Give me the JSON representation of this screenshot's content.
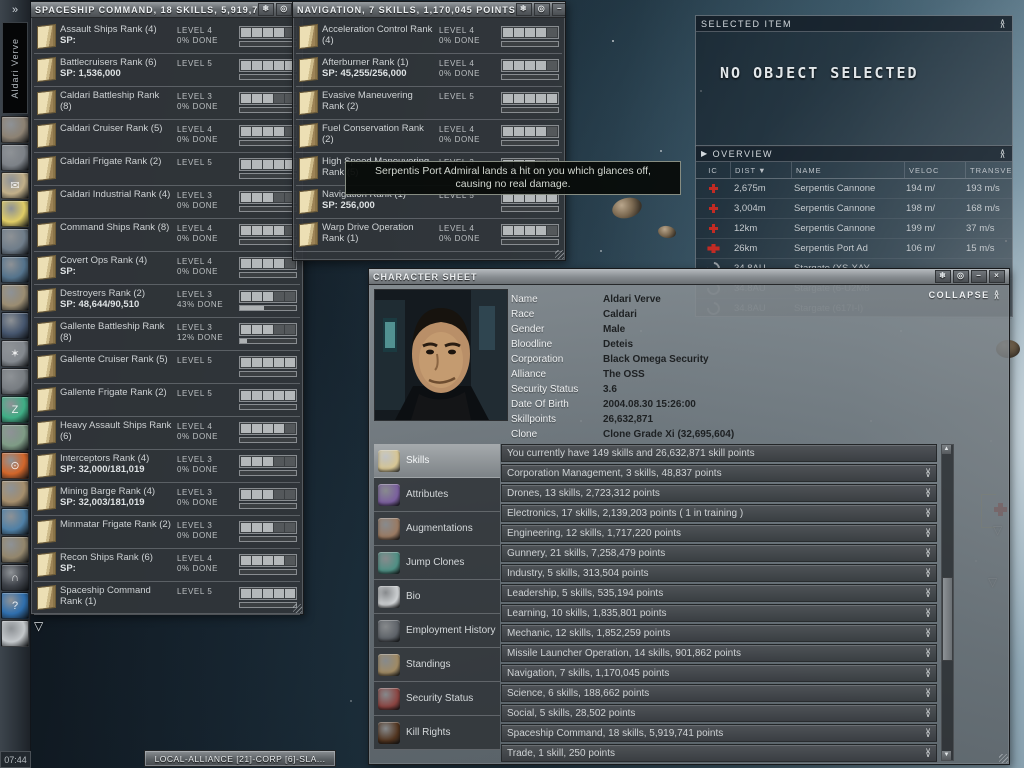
{
  "colors": {
    "hostile_red": "#c42b24",
    "skillbook_beige": "#e8ddb4",
    "accent_grey": "#b4b8ba"
  },
  "window_controls": {
    "pin": "❄",
    "compact": "◎",
    "minimize": "−",
    "close": "×"
  },
  "neocom": {
    "expand_icon": "»",
    "character_name": "Aldari Verve",
    "clock": "07:44",
    "icons": [
      {
        "name": "character-icon",
        "color": "#8d8273",
        "glyph": ""
      },
      {
        "name": "people-places-icon",
        "color": "#7d8288",
        "glyph": ""
      },
      {
        "name": "mail-icon",
        "color": "#c2b089",
        "glyph": "✉"
      },
      {
        "name": "notepad-icon",
        "color": "#e0cd66",
        "glyph": ""
      },
      {
        "name": "map-icon",
        "color": "#6f7d8a",
        "glyph": ""
      },
      {
        "name": "channels-icon",
        "color": "#54738c",
        "glyph": ""
      },
      {
        "name": "news-icon",
        "color": "#9b8d72",
        "glyph": ""
      },
      {
        "name": "fleet-icon",
        "color": "#46566e",
        "glyph": ""
      },
      {
        "name": "standings-stars-icon",
        "color": "#84898f",
        "glyph": "✶"
      },
      {
        "name": "assets-safe-icon",
        "color": "#787d82",
        "glyph": ""
      },
      {
        "name": "science-icon",
        "color": "#3fae85",
        "glyph": "Z"
      },
      {
        "name": "wallet-icon",
        "color": "#7f9c86",
        "glyph": ""
      },
      {
        "name": "help-icon",
        "color": "#d2662a",
        "glyph": "⊙"
      },
      {
        "name": "chat-icon",
        "color": "#a68f6d",
        "glyph": ""
      },
      {
        "name": "browser-globe-icon",
        "color": "#4f80a6",
        "glyph": ""
      },
      {
        "name": "journal-icon",
        "color": "#93866c",
        "glyph": ""
      },
      {
        "name": "audio-icon",
        "color": "#3f434a",
        "glyph": "∩"
      },
      {
        "name": "info-icon",
        "color": "#2f6fae",
        "glyph": "?"
      },
      {
        "name": "avatar-mask-icon",
        "color": "#c4c8cb",
        "glyph": ""
      }
    ]
  },
  "spaceship_window": {
    "title": "SPACESHIP COMMAND, 18 SKILLS, 5,919,7",
    "skills": [
      {
        "name": "Assault Ships Rank (4)",
        "sp": "SP:",
        "level": "LEVEL 4",
        "lv": 4,
        "done": "0% DONE",
        "pct": 0
      },
      {
        "name": "Battlecruisers Rank (6)",
        "sp": "SP: 1,536,000",
        "level": "LEVEL 5",
        "lv": 5,
        "done": "",
        "pct": 0
      },
      {
        "name": "Caldari Battleship Rank (8)",
        "sp": "",
        "level": "LEVEL 3",
        "lv": 3,
        "done": "0% DONE",
        "pct": 0
      },
      {
        "name": "Caldari Cruiser Rank (5)",
        "sp": "",
        "level": "LEVEL 4",
        "lv": 4,
        "done": "0% DONE",
        "pct": 0
      },
      {
        "name": "Caldari Frigate Rank (2)",
        "sp": "",
        "level": "LEVEL 5",
        "lv": 5,
        "done": "",
        "pct": 0
      },
      {
        "name": "Caldari Industrial Rank (4)",
        "sp": "",
        "level": "LEVEL 3",
        "lv": 3,
        "done": "0% DONE",
        "pct": 0
      },
      {
        "name": "Command Ships Rank (8)",
        "sp": "",
        "level": "LEVEL 4",
        "lv": 4,
        "done": "0% DONE",
        "pct": 0
      },
      {
        "name": "Covert Ops Rank (4)",
        "sp": "SP:",
        "level": "LEVEL 4",
        "lv": 4,
        "done": "0% DONE",
        "pct": 0
      },
      {
        "name": "Destroyers Rank (2)",
        "sp": "SP: 48,644/90,510",
        "level": "LEVEL 3",
        "lv": 3,
        "done": "43% DONE",
        "pct": 43
      },
      {
        "name": "Gallente Battleship Rank (8)",
        "sp": "",
        "level": "LEVEL 3",
        "lv": 3,
        "done": "12% DONE",
        "pct": 12
      },
      {
        "name": "Gallente Cruiser Rank (5)",
        "sp": "",
        "level": "LEVEL 5",
        "lv": 5,
        "done": "",
        "pct": 0
      },
      {
        "name": "Gallente Frigate Rank (2)",
        "sp": "",
        "level": "LEVEL 5",
        "lv": 5,
        "done": "",
        "pct": 0
      },
      {
        "name": "Heavy Assault Ships Rank (6)",
        "sp": "",
        "level": "LEVEL 4",
        "lv": 4,
        "done": "0% DONE",
        "pct": 0
      },
      {
        "name": "Interceptors Rank (4)",
        "sp": "SP: 32,000/181,019",
        "level": "LEVEL 3",
        "lv": 3,
        "done": "0% DONE",
        "pct": 0
      },
      {
        "name": "Mining Barge Rank (4)",
        "sp": "SP: 32,003/181,019",
        "level": "LEVEL 3",
        "lv": 3,
        "done": "0% DONE",
        "pct": 0
      },
      {
        "name": "Minmatar Frigate Rank (2)",
        "sp": "",
        "level": "LEVEL 3",
        "lv": 3,
        "done": "0% DONE",
        "pct": 0
      },
      {
        "name": "Recon Ships Rank (6)",
        "sp": "SP:",
        "level": "LEVEL 4",
        "lv": 4,
        "done": "0% DONE",
        "pct": 0
      },
      {
        "name": "Spaceship Command Rank (1)",
        "sp": "",
        "level": "LEVEL 5",
        "lv": 5,
        "done": "",
        "pct": 0
      }
    ]
  },
  "navigation_window": {
    "title": "NAVIGATION, 7 SKILLS, 1,170,045 POINTS",
    "skills": [
      {
        "name": "Acceleration Control Rank (4)",
        "sp": "",
        "level": "LEVEL 4",
        "lv": 4,
        "done": "0% DONE",
        "pct": 0
      },
      {
        "name": "Afterburner Rank (1)",
        "sp": "SP: 45,255/256,000",
        "level": "LEVEL 4",
        "lv": 4,
        "done": "0% DONE",
        "pct": 0
      },
      {
        "name": "Evasive Maneuvering Rank (2)",
        "sp": "",
        "level": "LEVEL 5",
        "lv": 5,
        "done": "",
        "pct": 0
      },
      {
        "name": "Fuel Conservation Rank (2)",
        "sp": "",
        "level": "LEVEL 4",
        "lv": 4,
        "done": "0% DONE",
        "pct": 0
      },
      {
        "name": "High Speed Maneuvering Rank (5)",
        "sp": "",
        "level": "LEVEL 3",
        "lv": 3,
        "done": "0% DONE",
        "pct": 0
      },
      {
        "name": "Navigation Rank (1)",
        "sp": "SP: 256,000",
        "level": "LEVEL 5",
        "lv": 5,
        "done": "",
        "pct": 0
      },
      {
        "name": "Warp Drive Operation Rank (1)",
        "sp": "",
        "level": "LEVEL 4",
        "lv": 4,
        "done": "0% DONE",
        "pct": 0
      }
    ]
  },
  "tooltip": {
    "line1": "Serpentis Port Admiral lands a hit on you which glances off,",
    "line2": "causing no real damage."
  },
  "selected_item": {
    "title": "SELECTED ITEM",
    "body": "NO OBJECT SELECTED"
  },
  "overview": {
    "title": "OVERVIEW",
    "expander_icon": "▶",
    "sort_icon": "▼",
    "sorted_column": "DIST",
    "columns": [
      "IC",
      "DIST",
      "NAME",
      "VELOC",
      "TRANSVERSAL V"
    ],
    "rows": [
      {
        "icon": "npc-hostile-cross-icon",
        "dist": "2,675m",
        "name": "Serpentis Cannone",
        "veloc": "194 m/",
        "transversal": "193 m/s",
        "dimmed": false,
        "large": false
      },
      {
        "icon": "npc-hostile-cross-icon",
        "dist": "3,004m",
        "name": "Serpentis Cannone",
        "veloc": "198 m/",
        "transversal": "168 m/s",
        "dimmed": false,
        "large": false
      },
      {
        "icon": "npc-hostile-cross-icon",
        "dist": "12km",
        "name": "Serpentis Cannone",
        "veloc": "199 m/",
        "transversal": "37 m/s",
        "dimmed": false,
        "large": false
      },
      {
        "icon": "npc-hostile-cross-icon",
        "dist": "26km",
        "name": "Serpentis Port Ad",
        "veloc": "106 m/",
        "transversal": "15 m/s",
        "dimmed": false,
        "large": true
      },
      {
        "icon": "stargate-icon",
        "dist": "34.8AU",
        "name": "Stargate (XS-XAY",
        "veloc": "",
        "transversal": "",
        "dimmed": false,
        "large": false
      },
      {
        "icon": "stargate-icon",
        "dist": "34.8AU",
        "name": "Stargate (6-U2M8",
        "veloc": "",
        "transversal": "",
        "dimmed": true,
        "large": false
      },
      {
        "icon": "stargate-icon",
        "dist": "34.8AU",
        "name": "Stargate (617I-I)",
        "veloc": "",
        "transversal": "",
        "dimmed": true,
        "large": false
      }
    ]
  },
  "character_sheet": {
    "title": "CHARACTER SHEET",
    "collapse_label": "COLLAPSE",
    "fields": [
      {
        "label": "Name",
        "value": "Aldari Verve"
      },
      {
        "label": "Race",
        "value": "Caldari"
      },
      {
        "label": "Gender",
        "value": "Male"
      },
      {
        "label": "Bloodline",
        "value": "Deteis"
      },
      {
        "label": "Corporation",
        "value": "Black Omega Security"
      },
      {
        "label": "Alliance",
        "value": "The OSS"
      },
      {
        "label": "Security Status",
        "value": "3.6"
      },
      {
        "label": "Date Of Birth",
        "value": "2004.08.30 15:26:00"
      },
      {
        "label": "Skillpoints",
        "value": "26,632,871"
      },
      {
        "label": "Clone",
        "value": "Clone Grade Xi (32,695,604)"
      }
    ],
    "tabs": [
      {
        "label": "Skills",
        "icon": "skills-book-icon",
        "color": "#d7c694",
        "active": true
      },
      {
        "label": "Attributes",
        "icon": "attributes-icon",
        "color": "#7a5f9e",
        "active": false
      },
      {
        "label": "Augmentations",
        "icon": "augmentations-icon",
        "color": "#9a7a62",
        "active": false
      },
      {
        "label": "Jump Clones",
        "icon": "jump-clones-icon",
        "color": "#4f8f84",
        "active": false
      },
      {
        "label": "Bio",
        "icon": "bio-icon",
        "color": "#cfd2d4",
        "active": false
      },
      {
        "label": "Employment History",
        "icon": "employment-history-icon",
        "color": "#5d6268",
        "active": false
      },
      {
        "label": "Standings",
        "icon": "standings-icon",
        "color": "#a08a64",
        "active": false
      },
      {
        "label": "Security Status",
        "icon": "security-status-icon",
        "color": "#8a4340",
        "active": false
      },
      {
        "label": "Kill Rights",
        "icon": "kill-rights-icon",
        "color": "#51341f",
        "active": false
      }
    ],
    "skills_summary": "You currently have 149 skills and 26,632,871 skill points",
    "groups": [
      "Corporation Management, 3 skills, 48,837 points",
      "Drones, 13 skills, 2,723,312 points",
      "Electronics, 17 skills, 2,139,203 points ( 1 in training )",
      "Engineering, 12 skills, 1,717,220 points",
      "Gunnery, 21 skills, 7,258,479 points",
      "Industry, 5 skills, 313,504 points",
      "Leadership, 5 skills, 535,194 points",
      "Learning, 10 skills, 1,835,801 points",
      "Mechanic, 12 skills, 1,852,259 points",
      "Missile Launcher Operation, 14 skills, 901,862 points",
      "Navigation, 7 skills, 1,170,045 points",
      "Science, 6 skills, 188,662 points",
      "Social, 5 skills, 28,502 points",
      "Spaceship Command, 18 skills, 5,919,741 points",
      "Trade, 1 skill, 250 points"
    ]
  },
  "taskbar": {
    "local_button": "LOCAL-ALLIANCE [21]-CORP [6]-SLA..."
  }
}
